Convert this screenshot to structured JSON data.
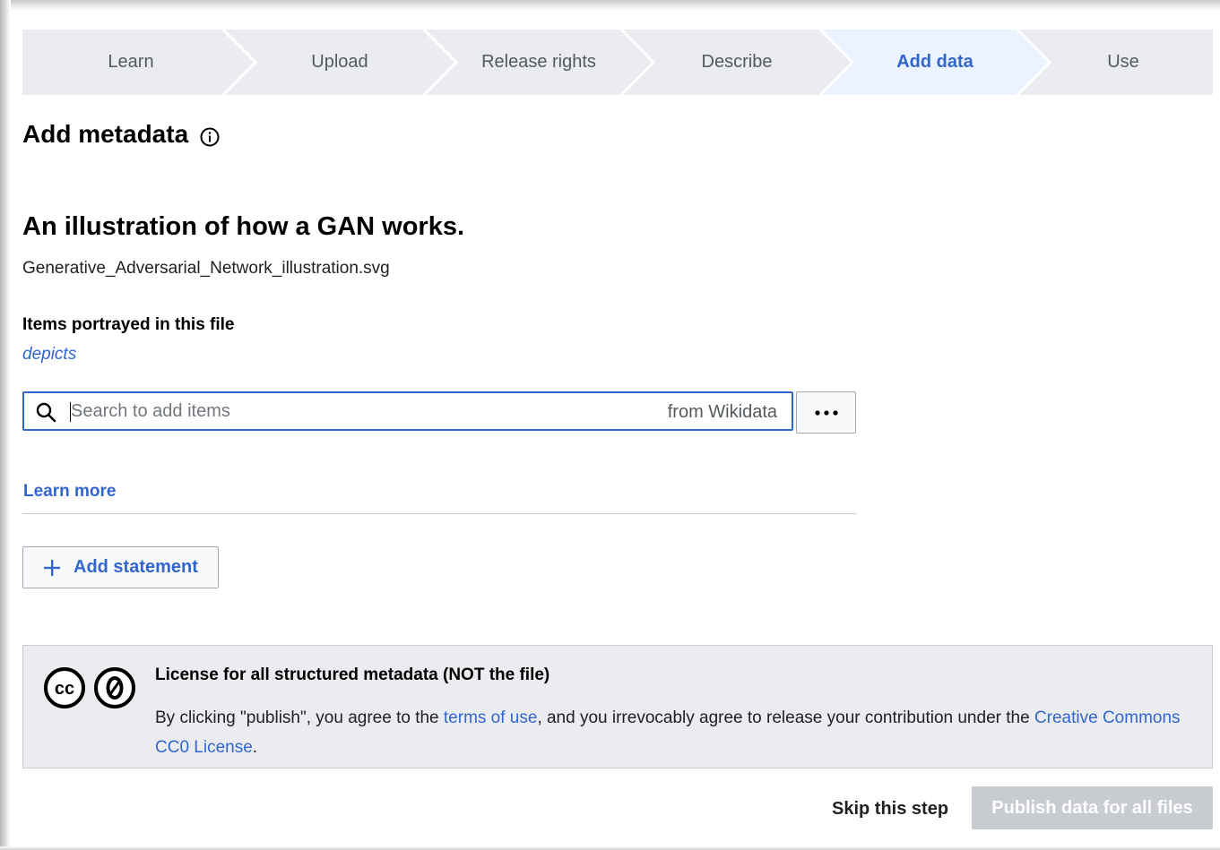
{
  "steps": [
    {
      "label": "Learn",
      "active": false
    },
    {
      "label": "Upload",
      "active": false
    },
    {
      "label": "Release rights",
      "active": false
    },
    {
      "label": "Describe",
      "active": false
    },
    {
      "label": "Add data",
      "active": true
    },
    {
      "label": "Use",
      "active": false
    }
  ],
  "colors": {
    "link": "#3366cc",
    "step_bg": "#eaecf0",
    "step_active_bg": "#eaf3ff",
    "license_bg": "#eaecf0",
    "disabled_button": "#c8ccd1"
  },
  "header": {
    "title": "Add metadata",
    "info_icon": "info-icon"
  },
  "file": {
    "title": "An illustration of how a GAN works.",
    "name": "Generative_Adversarial_Network_illustration.svg"
  },
  "depicts": {
    "heading": "Items portrayed in this file",
    "property_link": "depicts",
    "search_placeholder": "Search to add items",
    "search_value": "",
    "search_suffix": "from Wikidata",
    "search_icon": "search-icon",
    "more_icon": "ellipsis-icon"
  },
  "learn_more": "Learn more",
  "add_statement": {
    "label": "Add statement",
    "icon": "plus-icon"
  },
  "license": {
    "title": "License for all structured metadata (NOT the file)",
    "text_before": "By clicking \"publish\", you agree to the ",
    "terms_link": "terms of use",
    "text_middle": ", and you irrevocably agree to release your contribution under the ",
    "cc0_link": "Creative Commons CC0 License",
    "text_after": ".",
    "icons": [
      "cc-icon",
      "cc-zero-icon"
    ]
  },
  "footer": {
    "skip_label": "Skip this step",
    "publish_label": "Publish data for all files",
    "publish_enabled": false
  }
}
